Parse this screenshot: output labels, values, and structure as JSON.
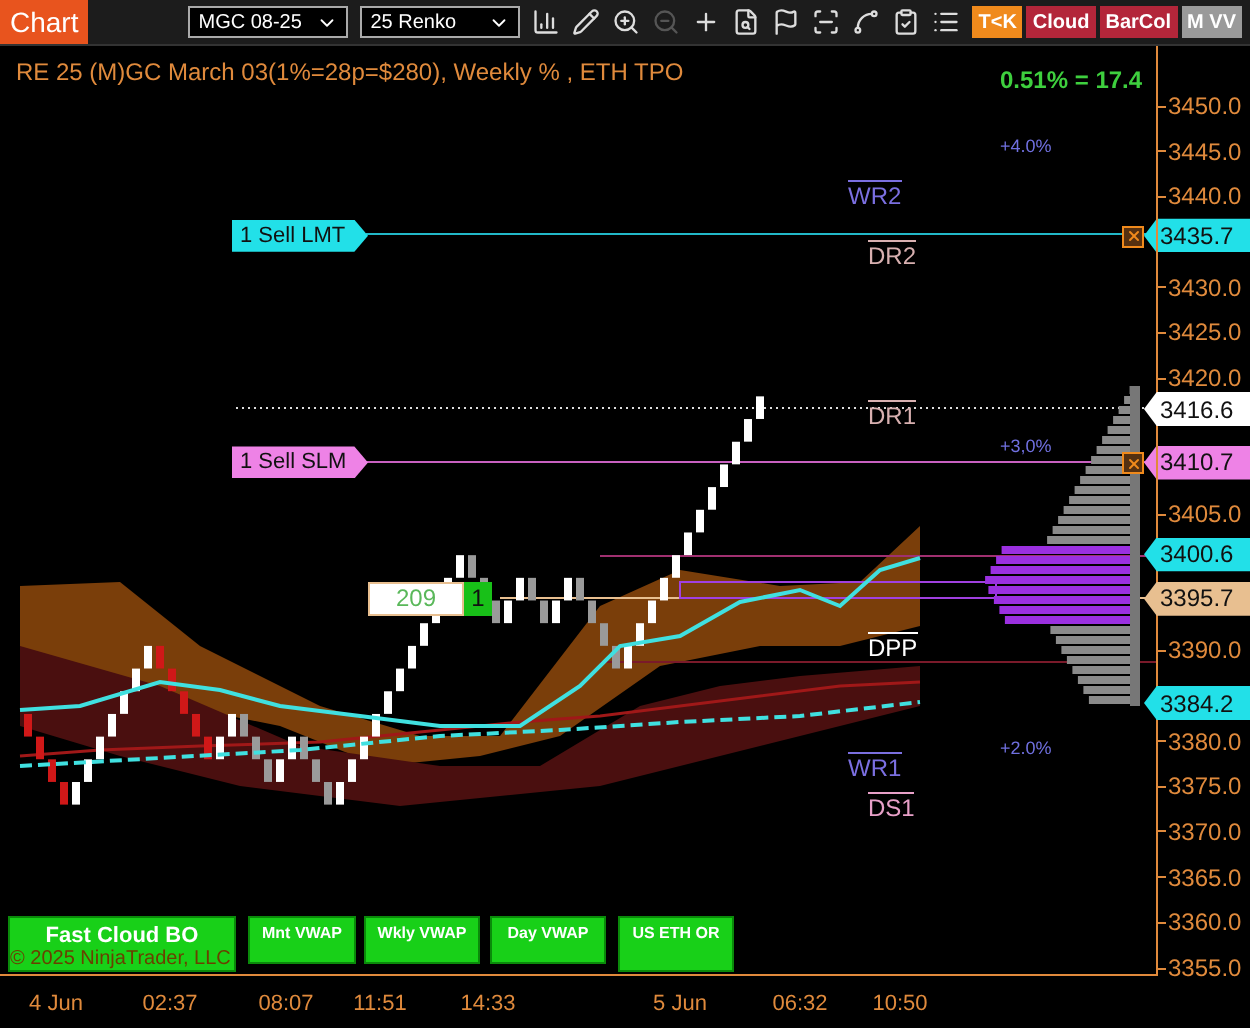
{
  "toolbar": {
    "title": "Chart",
    "instrument": "MGC 08-25",
    "bar_type": "25 Renko",
    "tools": [
      {
        "kind": "bars",
        "disabled": false
      },
      {
        "kind": "pencil",
        "disabled": false
      },
      {
        "kind": "zoom-in",
        "disabled": false
      },
      {
        "kind": "zoom-out",
        "disabled": true
      },
      {
        "kind": "crosshair",
        "disabled": false
      },
      {
        "kind": "doc-search",
        "disabled": false
      },
      {
        "kind": "flag",
        "disabled": false
      },
      {
        "kind": "scan",
        "disabled": false
      },
      {
        "kind": "spline",
        "disabled": false
      },
      {
        "kind": "checklist",
        "disabled": false
      },
      {
        "kind": "list",
        "disabled": false
      }
    ],
    "indicator_buttons": [
      {
        "label": "T<K",
        "color": "#f08a1c"
      },
      {
        "label": "Cloud",
        "color": "#b3263a"
      },
      {
        "label": "BarCol",
        "color": "#b3263a"
      },
      {
        "label": "M VV",
        "color": "#9a9a9a"
      }
    ]
  },
  "chart": {
    "header": "RE 25 (M)GC March 03(1%=28p=$280), Weekly % , ETH TPO",
    "change": "0.51% = 17.4",
    "percent_levels": [
      "+4.0%",
      "+3,0%",
      "+2.0%"
    ],
    "pivot_labels": [
      {
        "label": "WR2",
        "color": "#7b6fe0"
      },
      {
        "label": "DR2",
        "color": "#d8b0b0"
      },
      {
        "label": "DR1",
        "color": "#d8b0b0"
      },
      {
        "label": "DPP",
        "color": "#ffffff"
      },
      {
        "label": "WR1",
        "color": "#7b6fe0"
      },
      {
        "label": "DS1",
        "color": "#e8a0c8"
      }
    ],
    "orders": [
      {
        "label": "1 Sell LMT",
        "price": "3435.7",
        "color": "#22e0e8"
      },
      {
        "label": "1 Sell SLM",
        "price": "3410.7",
        "color": "#ee82e6"
      }
    ],
    "position": {
      "pnl": "209",
      "quantity": "1"
    },
    "price_tags": [
      {
        "price": "3416.6",
        "color": "#ffffff"
      },
      {
        "price": "3400.6",
        "color": "#22e0e8"
      },
      {
        "price": "3395.7",
        "color": "#e8bf90"
      },
      {
        "price": "3384.2",
        "color": "#22e0e8"
      }
    ],
    "price_axis": [
      "3450.0",
      "3445.0",
      "3440.0",
      "3430.0",
      "3425.0",
      "3420.0",
      "3405.0",
      "3390.0",
      "3380.0",
      "3375.0",
      "3370.0",
      "3365.0",
      "3360.0",
      "3355.0"
    ],
    "strategy_buttons": [
      "Fast Cloud BO",
      "Mnt VWAP",
      "Wkly VWAP",
      "Day VWAP",
      "US ETH OR"
    ],
    "copyright": "© 2025 NinjaTrader, LLC",
    "time_axis": [
      "4 Jun",
      "02:37",
      "08:07",
      "11:51",
      "14:33",
      "5 Jun",
      "06:32",
      "10:50"
    ]
  }
}
